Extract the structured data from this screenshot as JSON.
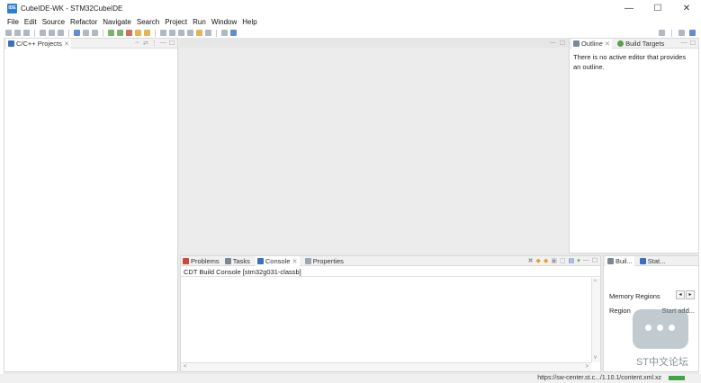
{
  "window": {
    "title": "CubeIDE-WK - STM32CubeIDE",
    "app_icon_text": "IDE",
    "minimize": "—",
    "maximize": "☐",
    "close": "✕"
  },
  "menu": [
    "File",
    "Edit",
    "Source",
    "Refactor",
    "Navigate",
    "Search",
    "Project",
    "Run",
    "Window",
    "Help"
  ],
  "project_explorer": {
    "tab_label": "C/C++ Projects"
  },
  "outline": {
    "tabs": [
      "Outline",
      "Build Targets"
    ],
    "message": "There is no active editor that provides an outline."
  },
  "console": {
    "tabs": [
      "Problems",
      "Tasks",
      "Console",
      "Properties"
    ],
    "header": "CDT Build Console [stm32g031-classb]"
  },
  "right_bottom": {
    "tabs": [
      "Buil...",
      "Stat..."
    ],
    "memory_title": "Memory Regions",
    "columns": [
      "Region",
      "Start add..."
    ]
  },
  "status": {
    "url": "https://sw-center.st.c.../1.10.1/content.xml.xz"
  },
  "watermark": {
    "text": "ST中文论坛"
  },
  "colors": {
    "workbench_bg": "#eaeaea",
    "accent": "#2f7fd0",
    "progress": "#3da843"
  }
}
